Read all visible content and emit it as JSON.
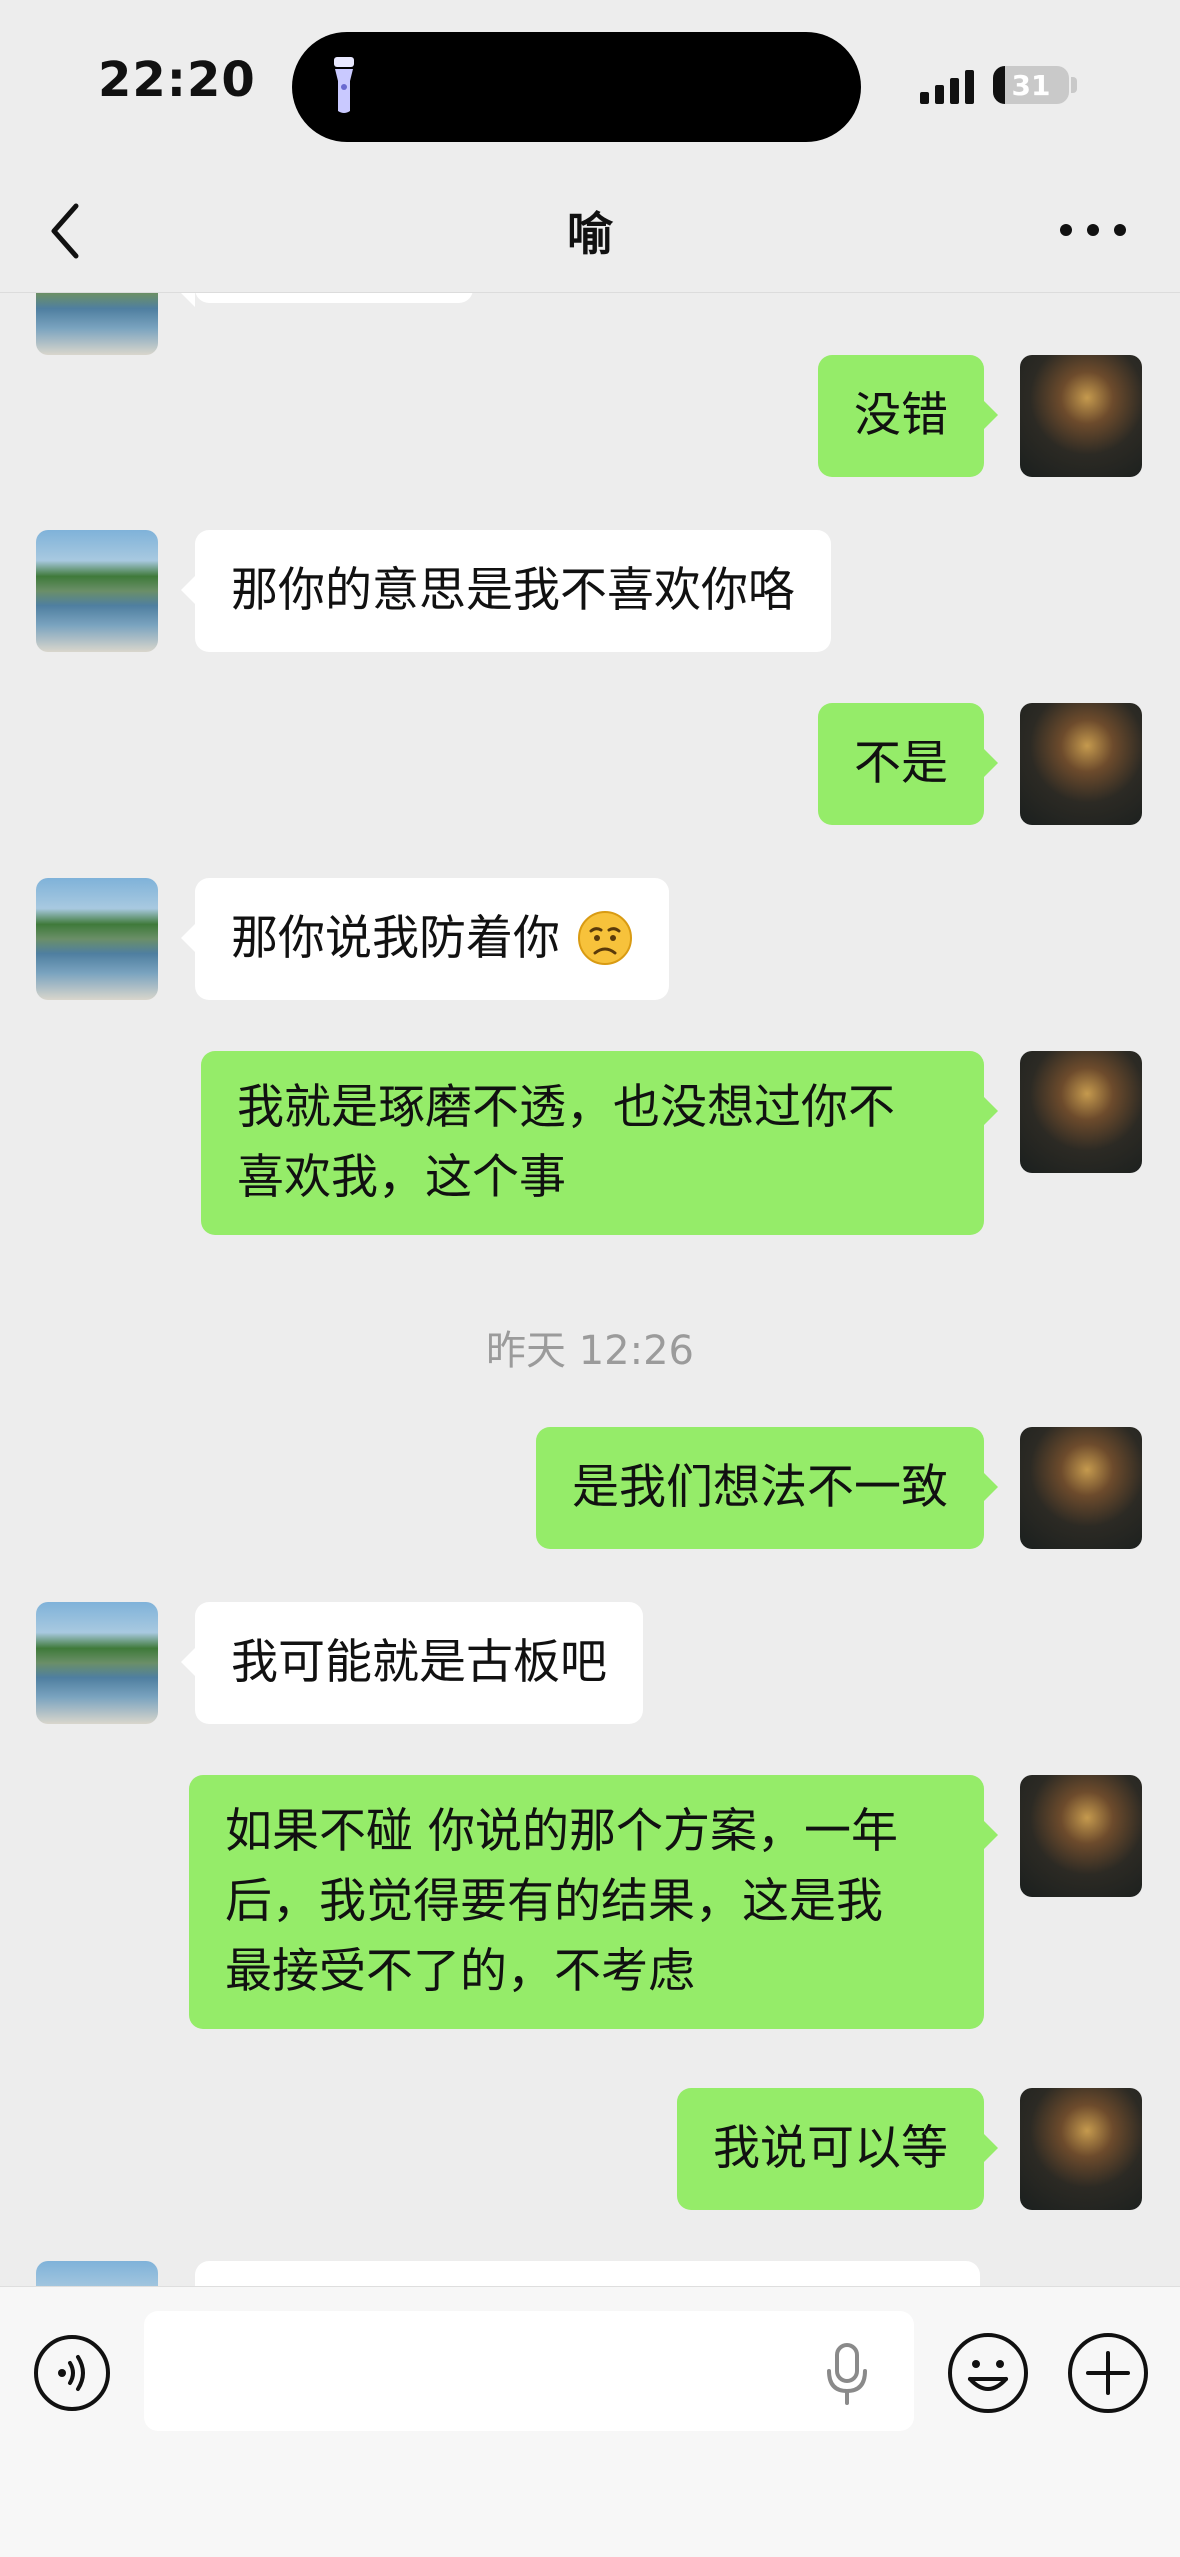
{
  "status_bar": {
    "time": "22:20",
    "battery": "31"
  },
  "header": {
    "title": "喻"
  },
  "messages": [
    {
      "id": "m1",
      "from": "me",
      "text": "没错"
    },
    {
      "id": "m2",
      "from": "other",
      "text": "那你的意思是我不喜欢你咯"
    },
    {
      "id": "m3",
      "from": "me",
      "text": "不是"
    },
    {
      "id": "m4",
      "from": "other",
      "text": "那你说我防着你"
    },
    {
      "id": "m5",
      "from": "me",
      "lines": [
        "我就是琢磨不透，也没想过你不",
        "喜欢我，这个事"
      ]
    },
    {
      "id": "m6",
      "from": "me",
      "text": "是我们想法不一致"
    },
    {
      "id": "m7",
      "from": "other",
      "text": "我可能就是古板吧"
    },
    {
      "id": "m8",
      "from": "me",
      "lines": [
        "如果不碰 你说的那个方案，一年",
        "后，我觉得要有的结果，这是我",
        "最接受不了的，不考虑"
      ]
    },
    {
      "id": "m9",
      "from": "me",
      "text": "我说可以等"
    }
  ],
  "timestamp": "昨天 12:26",
  "input_bar": {
    "placeholder": ""
  },
  "colors": {
    "background": "#ededed",
    "outgoing_bubble": "#95ec69",
    "incoming_bubble": "#ffffff",
    "timestamp": "#9b9b9b"
  },
  "icons": [
    "back-arrow-icon",
    "more-icon",
    "voice-toggle-icon",
    "microphone-icon",
    "emoji-icon",
    "plus-icon",
    "flashlight-icon",
    "signal-icon",
    "battery-icon"
  ]
}
